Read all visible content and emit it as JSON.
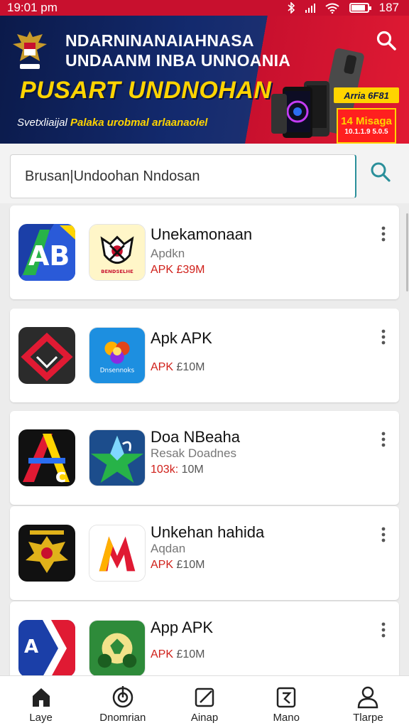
{
  "status_bar": {
    "time": "19:01 pm",
    "battery": "187",
    "battery_level": 0.9
  },
  "banner": {
    "line1": "NDARNINANAIAHNASA",
    "line2": "UNDAANM INBA UNNOANIA",
    "headline": "PUSART UNDNOHAN",
    "tagline_lead": "Svetxliaijal",
    "tagline_rest": "Palaka urobmal arlaanaolel",
    "promo_badge": "Arria 6F81",
    "promo_box_title": "14 Misaga",
    "promo_box_sub": "10.1.1.9 5.0.5"
  },
  "search": {
    "value": "Brusan|Undoohan Nndosan",
    "placeholder": ""
  },
  "apps": [
    {
      "title": "Unekamonaan",
      "subtitle": "Apdkn",
      "size_prefix": "APK",
      "size_value": "£39M"
    },
    {
      "title": "Apk APK",
      "subtitle": "",
      "size_prefix": "APK",
      "size_value": "£10M"
    },
    {
      "title": "Doa NBeaha",
      "subtitle": "Resak Doadnes",
      "size_prefix": "103k:",
      "size_value": "10M"
    },
    {
      "title": "Unkehan hahida",
      "subtitle": "Aqdan",
      "size_prefix": "APK",
      "size_value": "£10M"
    },
    {
      "title": "App APK",
      "subtitle": "",
      "size_prefix": "APK",
      "size_value": "£10M"
    }
  ],
  "app_icon_labels": {
    "icon1_app2_text": "Dnsennoks",
    "icon2_app1_text": "BENDSELHE"
  },
  "nav": [
    {
      "label": "Laye",
      "icon": "home-icon"
    },
    {
      "label": "Dnomrian",
      "icon": "download-icon"
    },
    {
      "label": "Ainap",
      "icon": "edit-icon"
    },
    {
      "label": "Mano",
      "icon": "menu-icon"
    },
    {
      "label": "Tlarpe",
      "icon": "profile-icon"
    }
  ],
  "colors": {
    "status_red": "#c8102e",
    "banner_navy": "#132a6e",
    "headline_yellow": "#ffd400",
    "accent_teal": "#2a8f9a",
    "apk_red": "#d0201a"
  }
}
